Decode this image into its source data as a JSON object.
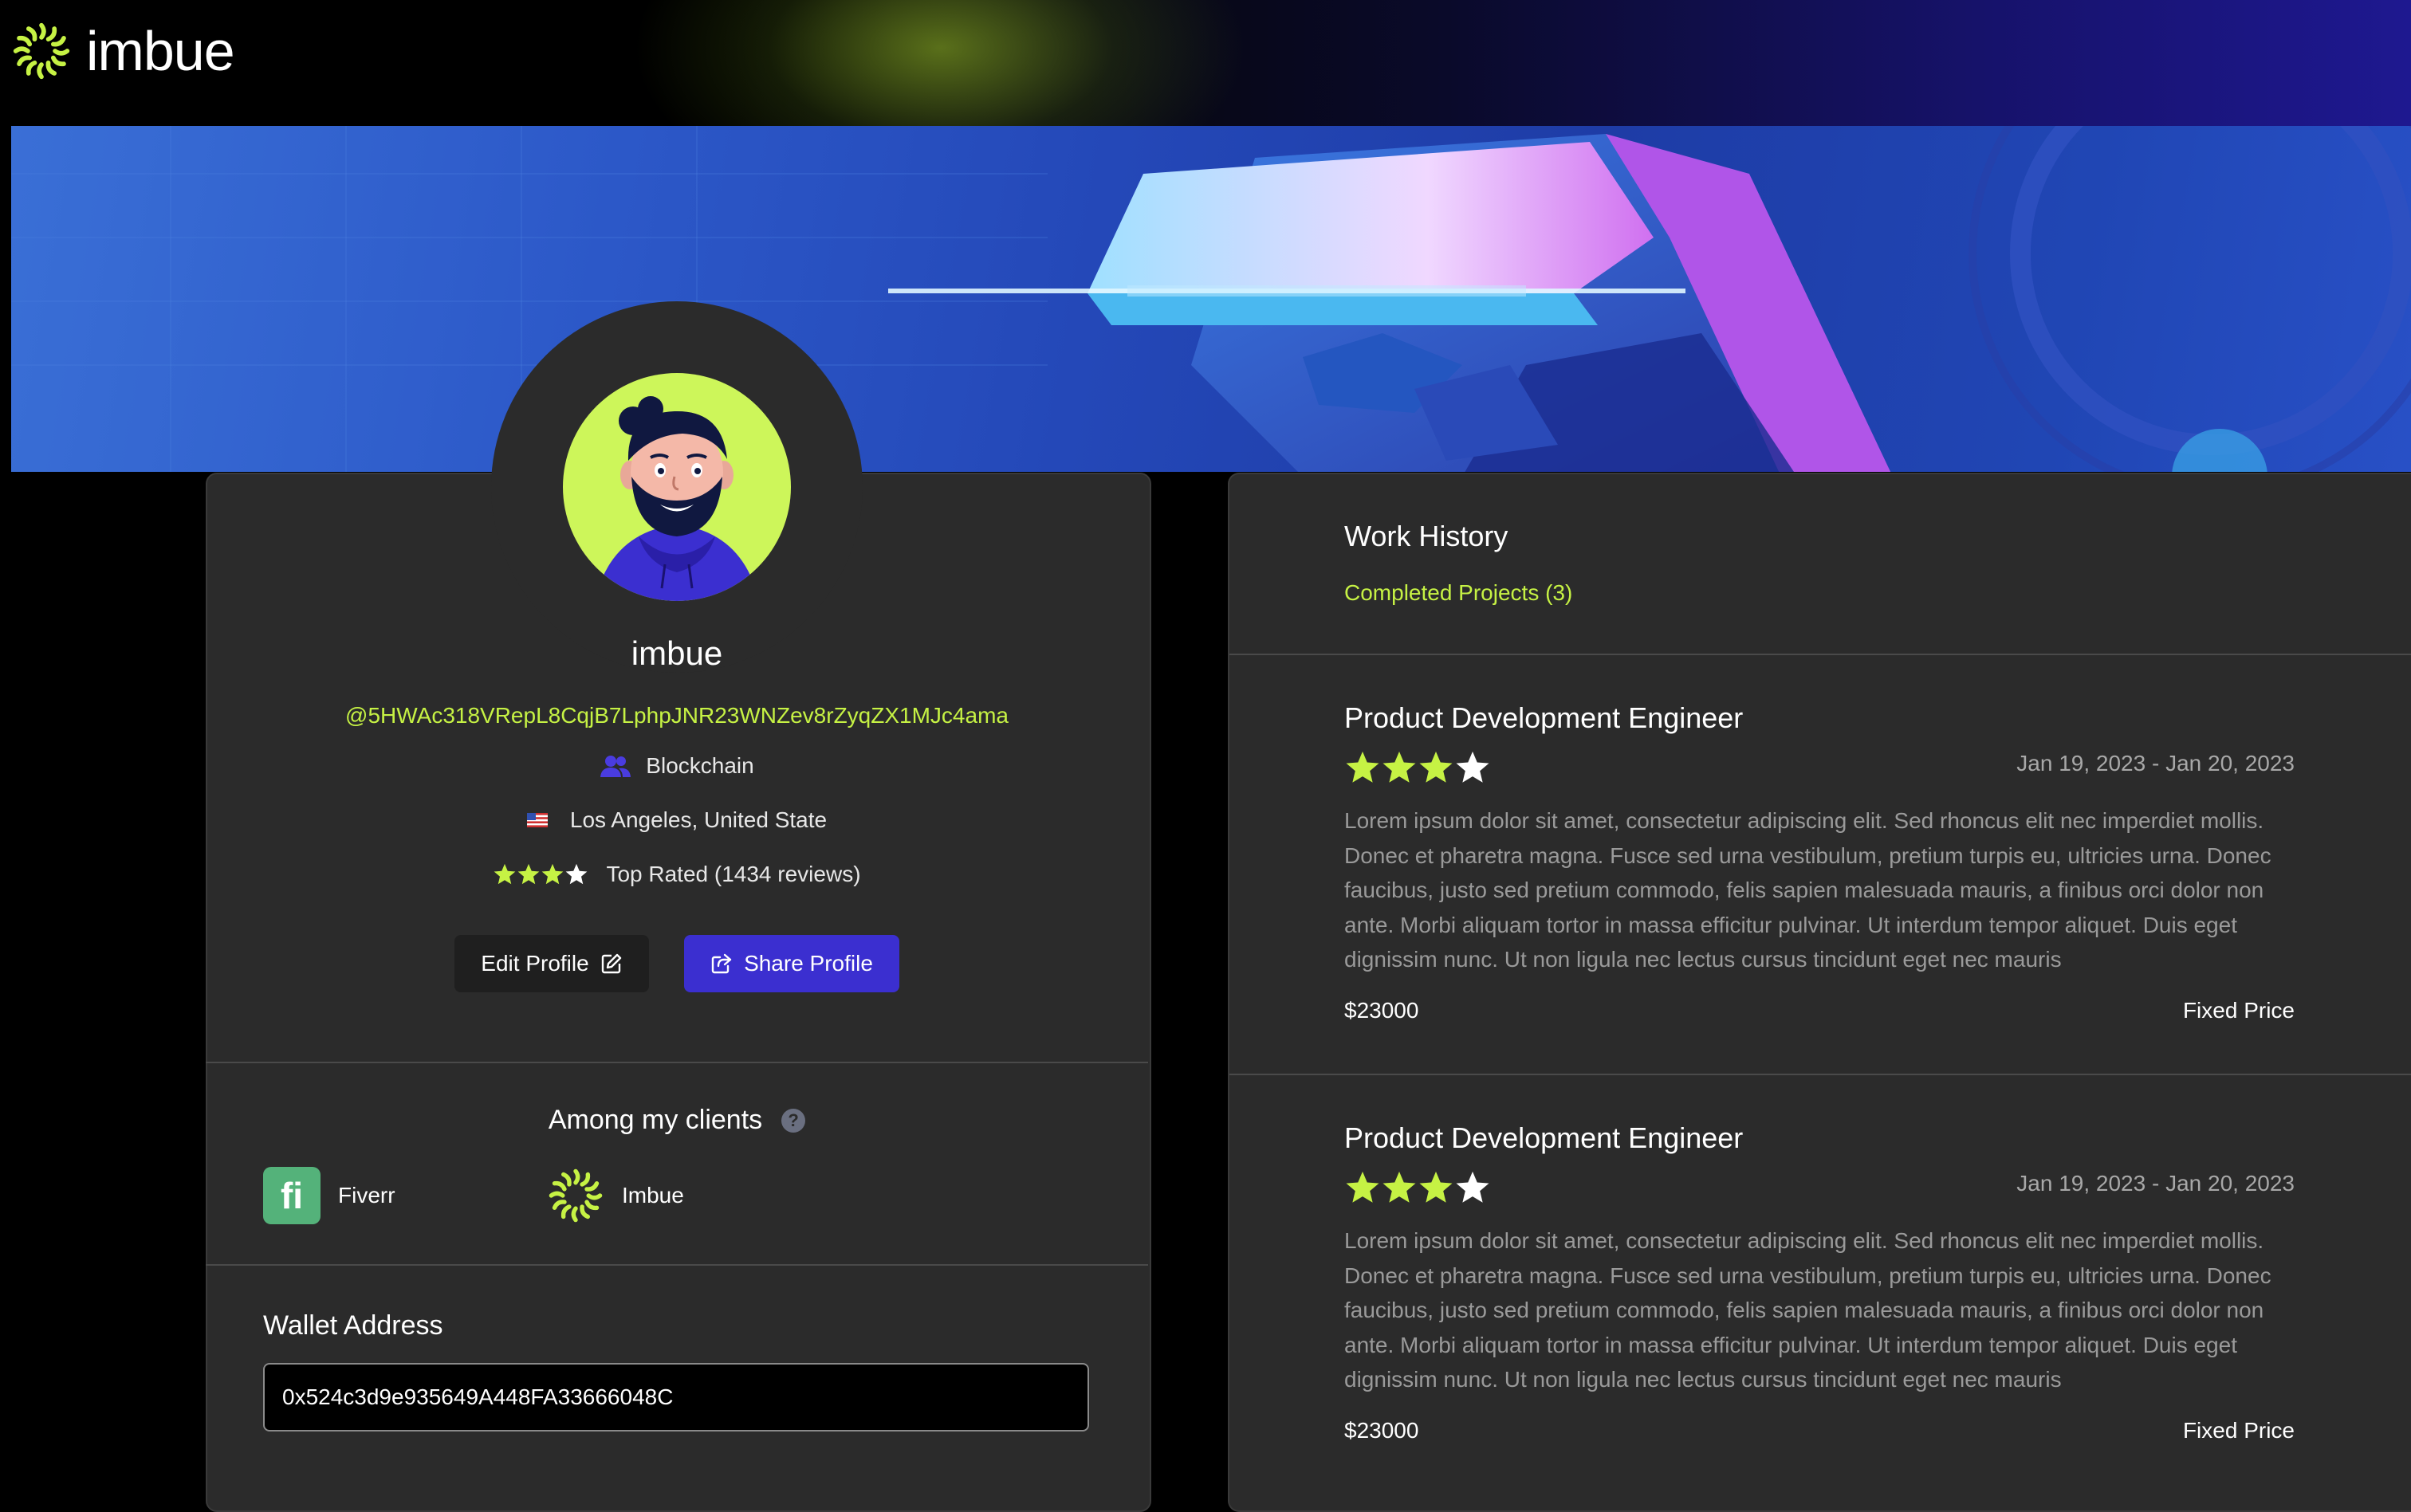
{
  "brand": {
    "name": "imbue"
  },
  "colors": {
    "accent_green": "#c6f244",
    "accent_purple": "#3b2fd0",
    "card_bg": "#2b2b2b"
  },
  "profile": {
    "display_name": "imbue",
    "handle": "@5HWAc318VRepL8CqjB7LphpJNR23WNZev8rZyqZX1MJc4ama",
    "category": "Blockchain",
    "location": "Los Angeles, United State",
    "rating_stars": 3,
    "rating_max": 4,
    "rating_text": "Top Rated (1434 reviews)",
    "edit_label": "Edit Profile",
    "share_label": "Share Profile",
    "icons": {
      "category": "users-icon",
      "location": "us-flag-icon",
      "edit": "edit-icon",
      "share": "share-icon"
    }
  },
  "clients": {
    "title": "Among my clients",
    "items": [
      {
        "name": "Fiverr",
        "logo": "fiverr-logo"
      },
      {
        "name": "Imbue",
        "logo": "imbue-logo"
      }
    ]
  },
  "wallet": {
    "label": "Wallet Address",
    "value": "0x524c3d9e935649A448FA33666048C"
  },
  "work_history": {
    "title": "Work History",
    "subtitle": "Completed Projects (3)",
    "projects": [
      {
        "title": "Product Development Engineer",
        "stars": 3,
        "stars_max": 4,
        "dates": "Jan 19, 2023 - Jan 20, 2023",
        "description": "Lorem ipsum dolor sit amet, consectetur adipiscing elit. Sed rhoncus elit nec imperdiet mollis. Donec et pharetra magna. Fusce sed urna vestibulum, pretium turpis eu, ultricies urna. Donec faucibus, justo sed pretium commodo, felis sapien malesuada mauris, a finibus orci dolor non ante. Morbi aliquam tortor in massa efficitur pulvinar. Ut interdum tempor aliquet. Duis eget dignissim nunc. Ut non ligula nec lectus cursus tincidunt eget nec mauris",
        "price": "$23000",
        "price_type": "Fixed Price"
      },
      {
        "title": "Product Development Engineer",
        "stars": 3,
        "stars_max": 4,
        "dates": "Jan 19, 2023 - Jan 20, 2023",
        "description": "Lorem ipsum dolor sit amet, consectetur adipiscing elit. Sed rhoncus elit nec imperdiet mollis. Donec et pharetra magna. Fusce sed urna vestibulum, pretium turpis eu, ultricies urna. Donec faucibus, justo sed pretium commodo, felis sapien malesuada mauris, a finibus orci dolor non ante. Morbi aliquam tortor in massa efficitur pulvinar. Ut interdum tempor aliquet. Duis eget dignissim nunc. Ut non ligula nec lectus cursus tincidunt eget nec mauris",
        "price": "$23000",
        "price_type": "Fixed Price"
      }
    ]
  }
}
